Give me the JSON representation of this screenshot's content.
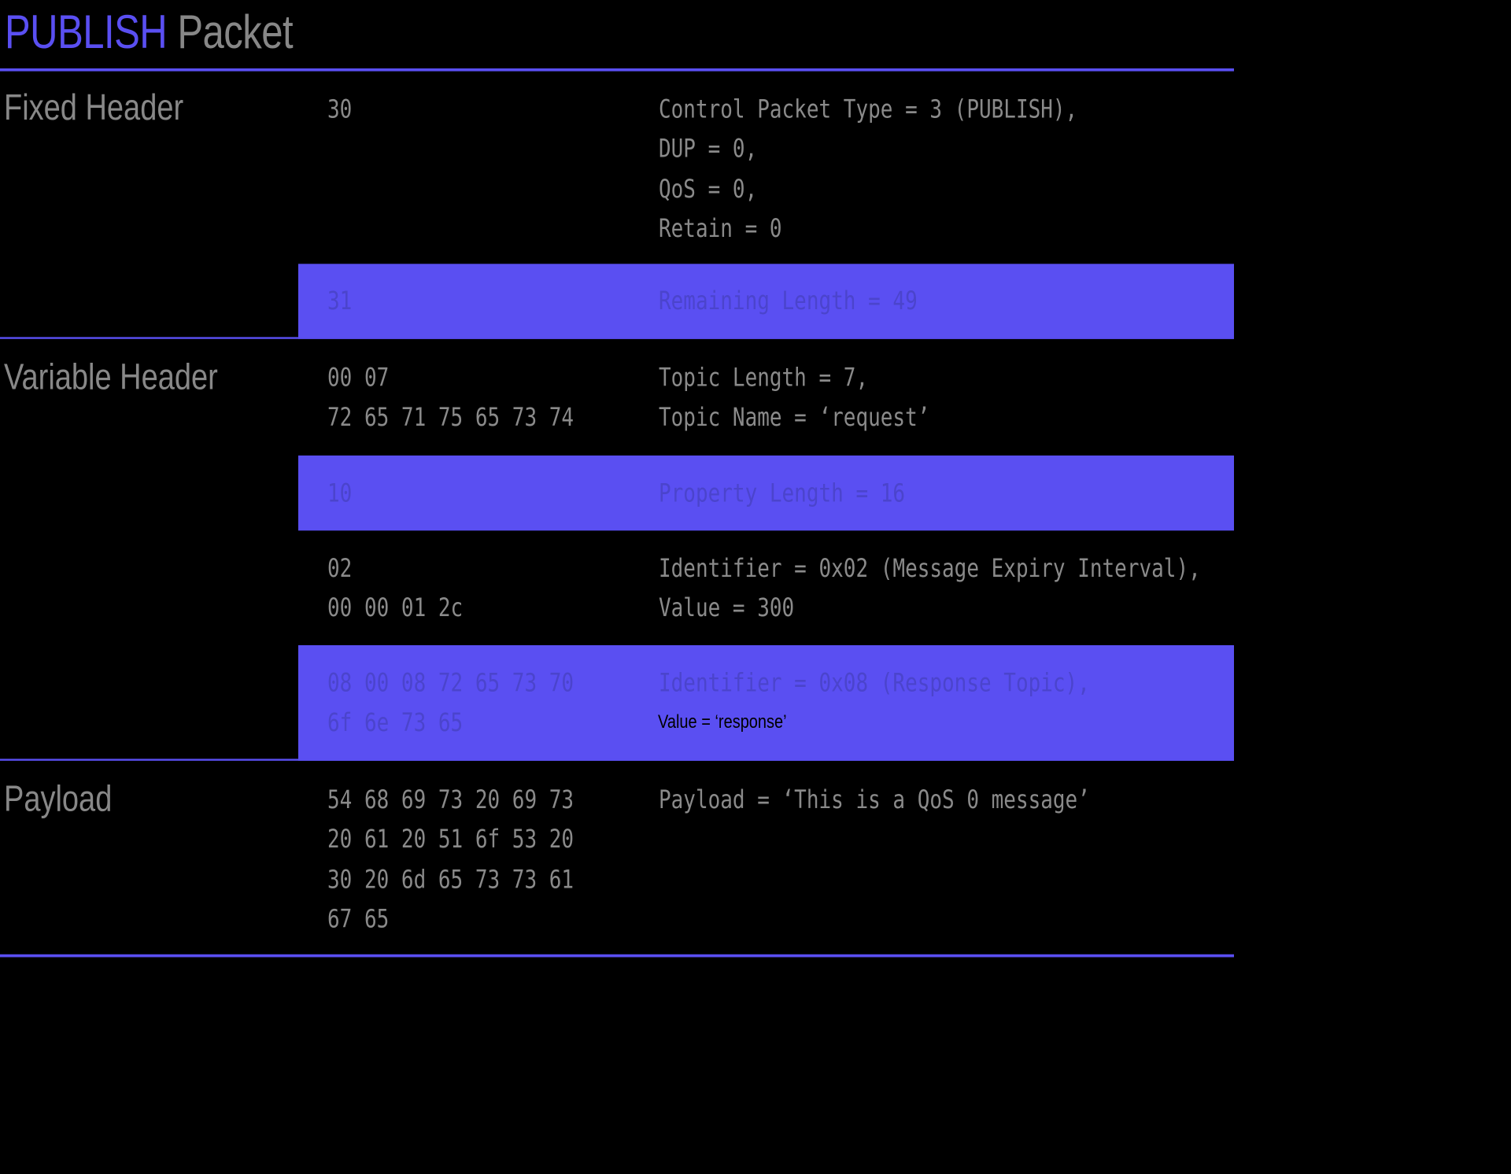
{
  "title": {
    "accent": "PUBLISH",
    "rest": "Packet"
  },
  "sections": {
    "fixed_header": "Fixed Header",
    "variable_header": "Variable Header",
    "payload": "Payload"
  },
  "rows": {
    "control": {
      "hex": "30",
      "desc": "Control Packet Type = 3 (PUBLISH),\nDUP = 0,\nQoS = 0,\nRetain = 0"
    },
    "remaining_length": {
      "hex": "31",
      "desc": "Remaining Length = 49"
    },
    "topic": {
      "hex": "00 07\n72 65 71 75 65 73 74",
      "desc": "Topic Length = 7,\nTopic Name = ‘request’"
    },
    "property_length": {
      "hex": "10",
      "desc": "Property Length = 16"
    },
    "expiry": {
      "hex": "02\n00 00 01 2c",
      "desc": "Identifier = 0x02 (Message Expiry Interval),\nValue = 300"
    },
    "response_topic": {
      "hex": "08 00 08 72 65 73 70\n6f 6e 73 65",
      "desc": "Identifier = 0x08 (Response Topic),",
      "value_note": "Value = ‘response’"
    },
    "payload": {
      "hex": "54 68 69 73 20 69 73\n20 61 20 51 6f 53 20\n30 20 6d 65 73 73 61\n67 65",
      "desc": "Payload = ‘This is a QoS 0 message’"
    }
  },
  "colors": {
    "accent": "#5a4ff2",
    "background": "#000000",
    "text_gray": "#8a8a8a",
    "text_on_band": "#4b44cc"
  }
}
